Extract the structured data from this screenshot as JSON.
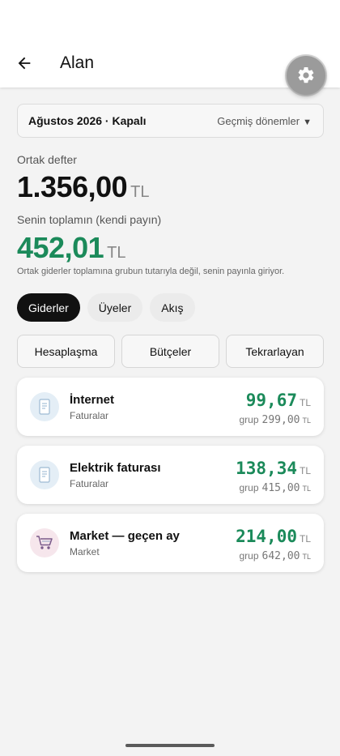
{
  "header": {
    "title": "Alan",
    "back_icon": "arrow-left-icon",
    "settings_icon": "gear-icon"
  },
  "period": {
    "label": "Ağustos 2026 · Kapalı",
    "history_link": "Geçmiş dönemler",
    "caret": "▼"
  },
  "summary": {
    "shared_label": "Ortak defter",
    "shared_amount": "1.356,00",
    "shared_currency": "TL",
    "own_label": "Senin toplamın (kendi payın)",
    "own_amount": "452,01",
    "own_currency": "TL",
    "note": "Ortak giderler toplamına grubun tutarıyla değil, senin payınla giriyor."
  },
  "tabs": [
    {
      "label": "Giderler",
      "active": true
    },
    {
      "label": "Üyeler",
      "active": false
    },
    {
      "label": "Akış",
      "active": false
    }
  ],
  "actions": [
    {
      "label": "Hesaplaşma"
    },
    {
      "label": "Bütçeler"
    },
    {
      "label": "Tekrarlayan"
    }
  ],
  "expenses": [
    {
      "name": "İnternet",
      "category": "Faturalar",
      "amount": "99,67",
      "currency": "TL",
      "group_label": "grup",
      "group_amount": "299,00",
      "group_currency": "TL",
      "icon": "receipt-icon",
      "icon_bg": "#e4eef6"
    },
    {
      "name": "Elektrik faturası",
      "category": "Faturalar",
      "amount": "138,34",
      "currency": "TL",
      "group_label": "grup",
      "group_amount": "415,00",
      "group_currency": "TL",
      "icon": "receipt-icon",
      "icon_bg": "#e4eef6"
    },
    {
      "name": "Market — geçen ay",
      "category": "Market",
      "amount": "214,00",
      "currency": "TL",
      "group_label": "grup",
      "group_amount": "642,00",
      "group_currency": "TL",
      "icon": "shopping-cart-icon",
      "icon_bg": "#f6e6ec"
    }
  ],
  "colors": {
    "accent_green": "#1b8a5a",
    "active_tab": "#111111",
    "fab": "#9b9b9b"
  }
}
